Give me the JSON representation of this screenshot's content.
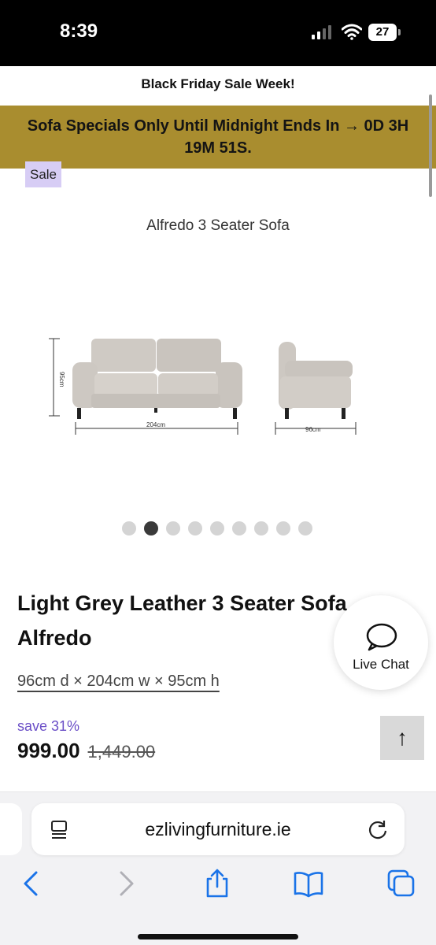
{
  "status_bar": {
    "time": "8:39",
    "battery": "27"
  },
  "promo": {
    "top_text": "Black Friday Sale Week!",
    "banner_text": "Sofa Specials Only Until Midnight Ends In → 0D 3H 19M 51S.",
    "banner_color": "#a98d2f"
  },
  "product": {
    "badge": "Sale",
    "image_caption": "Alfredo 3 Seater Sofa",
    "image_labels": {
      "height": "95cm",
      "width": "204cm",
      "depth": "96cm"
    },
    "carousel": {
      "total": 9,
      "active_index": 2
    },
    "title": "Light Grey Leather 3 Seater Sofa Alfredo",
    "dimensions": "96cm d × 204cm w × 95cm h",
    "save_text": "save 31%",
    "price": "999.00",
    "old_price": "1,449.00"
  },
  "live_chat": {
    "label": "Live Chat",
    "icon": "chat-bubble-icon"
  },
  "scroll_top": {
    "icon": "arrow-up-icon",
    "glyph": "↑"
  },
  "browser": {
    "url": "ezlivingfurniture.ie",
    "icons": [
      "reader-icon",
      "reload-icon",
      "back-icon",
      "forward-icon",
      "share-icon",
      "bookmarks-icon",
      "tabs-icon"
    ],
    "accent_color": "#1a73e8"
  }
}
